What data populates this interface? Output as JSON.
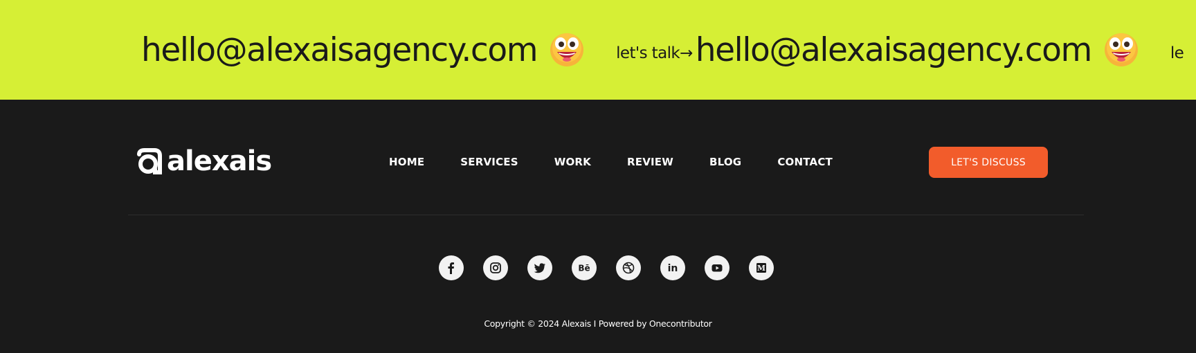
{
  "marquee": {
    "email_1": "hello@alexaisagency.com",
    "talk_1": "let's talk→",
    "email_2": "hello@alexaisagency.com",
    "talk_2": "le",
    "emoji": "grinning-face-emoji",
    "background": "#d6ef35"
  },
  "brand": {
    "name": "alexais"
  },
  "nav": {
    "items": [
      "HOME",
      "SERVICES",
      "WORK",
      "REVIEW",
      "BLOG",
      "CONTACT"
    ]
  },
  "cta": {
    "label": "LET'S DISCUSS",
    "color": "#f25c2b"
  },
  "socials": {
    "icons": [
      "facebook-icon",
      "instagram-icon",
      "twitter-icon",
      "behance-icon",
      "dribbble-icon",
      "linkedin-icon",
      "youtube-icon",
      "medium-icon"
    ],
    "behance_text": "Bē",
    "linkedin_text": "in",
    "medium_text": "M"
  },
  "footer": {
    "copyright": "Copyright © 2024 Alexais I Powered by Onecontributor",
    "background": "#1a1a1a"
  }
}
